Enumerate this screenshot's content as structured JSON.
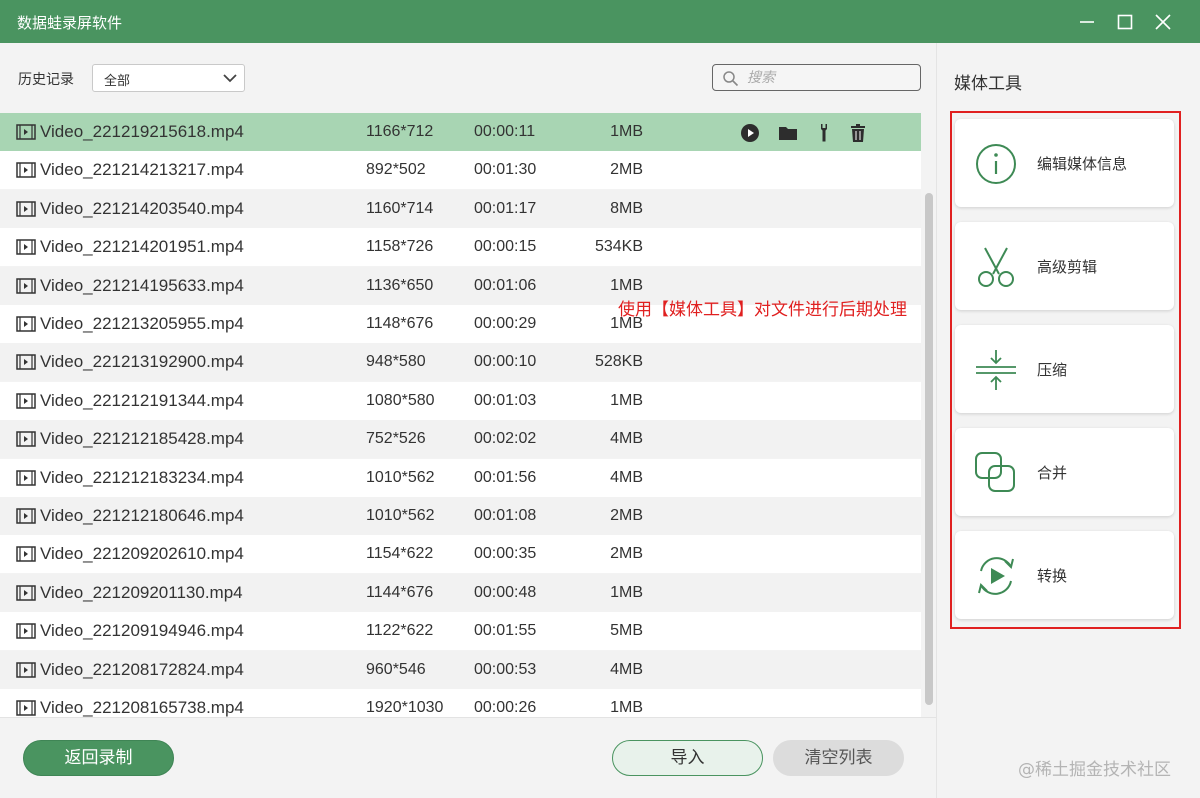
{
  "window": {
    "title": "数据蛙录屏软件",
    "accent": "#4a9460"
  },
  "toolbar": {
    "history_label": "历史记录",
    "filter_value": "全部",
    "search_placeholder": "搜索"
  },
  "files": [
    {
      "name": "Video_221219215618.mp4",
      "resolution": "1166*712",
      "duration": "00:00:11",
      "size": "1MB",
      "selected": true
    },
    {
      "name": "Video_221214213217.mp4",
      "resolution": "892*502",
      "duration": "00:01:30",
      "size": "2MB"
    },
    {
      "name": "Video_221214203540.mp4",
      "resolution": "1160*714",
      "duration": "00:01:17",
      "size": "8MB"
    },
    {
      "name": "Video_221214201951.mp4",
      "resolution": "1158*726",
      "duration": "00:00:15",
      "size": "534KB"
    },
    {
      "name": "Video_221214195633.mp4",
      "resolution": "1136*650",
      "duration": "00:01:06",
      "size": "1MB"
    },
    {
      "name": "Video_221213205955.mp4",
      "resolution": "1148*676",
      "duration": "00:00:29",
      "size": "1MB"
    },
    {
      "name": "Video_221213192900.mp4",
      "resolution": "948*580",
      "duration": "00:00:10",
      "size": "528KB"
    },
    {
      "name": "Video_221212191344.mp4",
      "resolution": "1080*580",
      "duration": "00:01:03",
      "size": "1MB"
    },
    {
      "name": "Video_221212185428.mp4",
      "resolution": "752*526",
      "duration": "00:02:02",
      "size": "4MB"
    },
    {
      "name": "Video_221212183234.mp4",
      "resolution": "1010*562",
      "duration": "00:01:56",
      "size": "4MB"
    },
    {
      "name": "Video_221212180646.mp4",
      "resolution": "1010*562",
      "duration": "00:01:08",
      "size": "2MB"
    },
    {
      "name": "Video_221209202610.mp4",
      "resolution": "1154*622",
      "duration": "00:00:35",
      "size": "2MB"
    },
    {
      "name": "Video_221209201130.mp4",
      "resolution": "1144*676",
      "duration": "00:00:48",
      "size": "1MB"
    },
    {
      "name": "Video_221209194946.mp4",
      "resolution": "1122*622",
      "duration": "00:01:55",
      "size": "5MB"
    },
    {
      "name": "Video_221208172824.mp4",
      "resolution": "960*546",
      "duration": "00:00:53",
      "size": "4MB"
    },
    {
      "name": "Video_221208165738.mp4",
      "resolution": "1920*1030",
      "duration": "00:00:26",
      "size": "1MB"
    }
  ],
  "row_actions": [
    "play-icon",
    "folder-icon",
    "wrench-icon",
    "trash-icon"
  ],
  "annotation": "使用【媒体工具】对文件进行后期处理",
  "annotation_color": "#e02020",
  "buttons": {
    "back": "返回录制",
    "import": "导入",
    "clear": "清空列表"
  },
  "media_tools": {
    "title": "媒体工具",
    "items": [
      {
        "label": "编辑媒体信息",
        "icon": "info-icon"
      },
      {
        "label": "高级剪辑",
        "icon": "scissors-icon"
      },
      {
        "label": "压缩",
        "icon": "compress-icon"
      },
      {
        "label": "合并",
        "icon": "merge-icon"
      },
      {
        "label": "转换",
        "icon": "convert-icon"
      }
    ]
  },
  "watermark": "@稀土掘金技术社区"
}
